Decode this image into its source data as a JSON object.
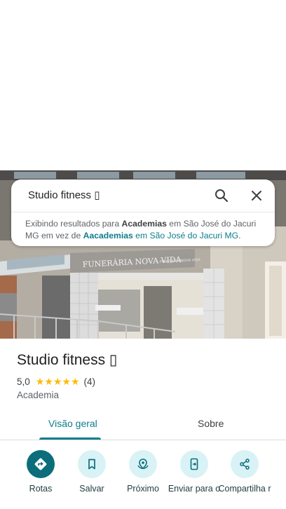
{
  "search": {
    "query": "Studio fitness ▯",
    "note_prefix": "Exibindo resultados para ",
    "note_term": "Academias",
    "note_middle": " em São José do Jacuri MG em vez de ",
    "note_original_term": "Aacademias",
    "note_original_rest": " em São José do Jacuri MG",
    "note_suffix": "."
  },
  "photo": {
    "signage_main": "FUNERÁRIA NOVA VIDA",
    "signage_small": "FUNERÁRIA NOVA VIDA"
  },
  "place": {
    "name": "Studio fitness ▯",
    "rating": "5,0",
    "stars": "★★★★★",
    "reviews": "(4)",
    "category": "Academia"
  },
  "tabs": [
    {
      "label": "Visão geral",
      "active": true
    },
    {
      "label": "Sobre",
      "active": false
    }
  ],
  "actions": [
    {
      "label": "Rotas",
      "icon": "directions-icon"
    },
    {
      "label": "Salvar",
      "icon": "bookmark-icon"
    },
    {
      "label": "Próximo",
      "icon": "nearby-icon"
    },
    {
      "label": "Enviar para o",
      "icon": "send-to-phone-icon"
    },
    {
      "label": "Compartilha r",
      "icon": "share-icon"
    }
  ],
  "colors": {
    "accent": "#0b7d8c",
    "primary_action": "#0b6e7a",
    "action_bg": "#d9f2f6",
    "star": "#fbbc04"
  }
}
